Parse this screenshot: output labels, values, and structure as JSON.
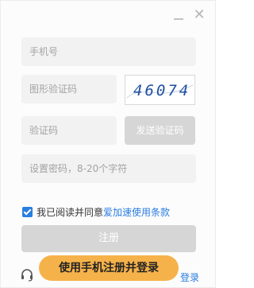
{
  "window": {
    "minimize_label": "",
    "close_label": "✕"
  },
  "form": {
    "phone_placeholder": "手机号",
    "captcha_placeholder": "图形验证码",
    "captcha_image_text": "46074",
    "sms_placeholder": "验证码",
    "send_code_label": "发送验证码",
    "password_placeholder": "设置密码，8-20个字符"
  },
  "agreement": {
    "checked": true,
    "text": "我已阅读并同意",
    "link": "爱加速使用条款"
  },
  "register_label": "注册",
  "footer": {
    "phone_register_label": "使用手机注册并登录",
    "login_link": "登录"
  },
  "colors": {
    "accent": "#2a7de1",
    "cta": "#f6b24a",
    "disabled": "#d6d6d6"
  }
}
